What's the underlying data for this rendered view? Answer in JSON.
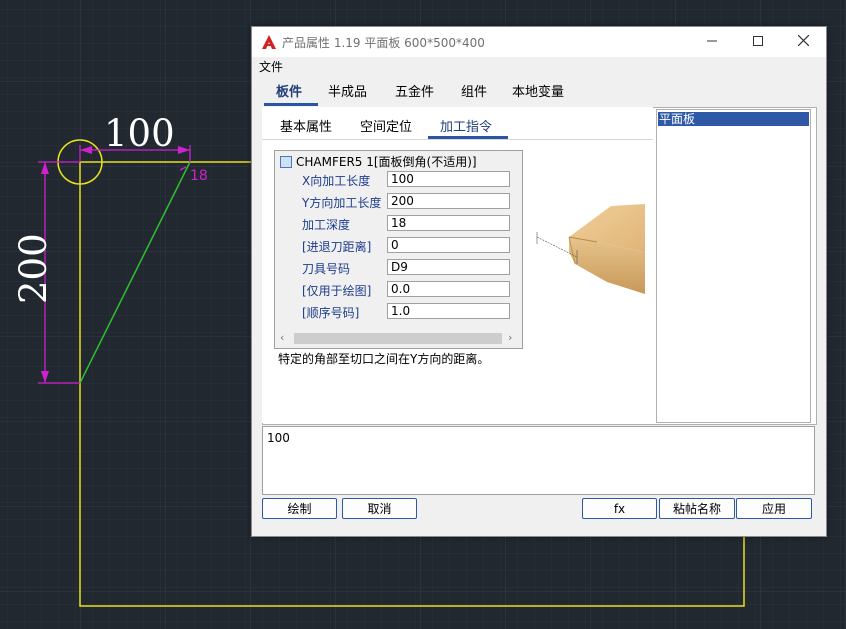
{
  "cad": {
    "dim_top": "100",
    "dim_left": "200",
    "dim_small": "18",
    "colors": {
      "background": "#212830",
      "outline": "#e8e020",
      "dimension": "#d020d0",
      "diagonal": "#30c030"
    }
  },
  "dialog": {
    "title": "产品属性 1.19 平面板 600*500*400",
    "menu": {
      "file": "文件"
    },
    "tabs": [
      "板件",
      "半成品",
      "五金件",
      "组件",
      "本地变量"
    ],
    "subtabs": [
      "基本属性",
      "空间定位",
      "加工指令"
    ],
    "command": {
      "title": "CHAMFER5 1[面板倒角(不适用)]",
      "properties": [
        {
          "label": "X向加工长度",
          "value": "100"
        },
        {
          "label": "Y方向加工长度",
          "value": "200"
        },
        {
          "label": "加工深度",
          "value": "18"
        },
        {
          "label": "[进退刀距离]",
          "value": "0"
        },
        {
          "label": "刀具号码",
          "value": "D9"
        },
        {
          "label": "[仅用于绘图]",
          "value": "0.0"
        },
        {
          "label": "[顺序号码]",
          "value": "1.0"
        }
      ]
    },
    "hint": "特定的角部至切口之间在Y方向的距离。",
    "list_items": [
      "平面板"
    ],
    "output": "100",
    "buttons": {
      "draw": "绘制",
      "cancel": "取消",
      "fx": "fx",
      "paste_name": "粘帖名称",
      "apply": "应用"
    },
    "icons": {
      "app": "autocad-icon",
      "minimize": "minimize-icon",
      "maximize": "maximize-icon",
      "close": "close-icon"
    }
  }
}
